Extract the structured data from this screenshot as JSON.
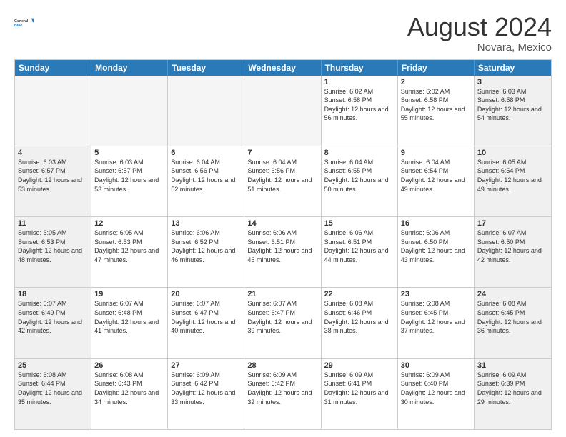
{
  "header": {
    "logo_line1": "General",
    "logo_line2": "Blue",
    "main_title": "August 2024",
    "subtitle": "Novara, Mexico"
  },
  "calendar": {
    "day_headers": [
      "Sunday",
      "Monday",
      "Tuesday",
      "Wednesday",
      "Thursday",
      "Friday",
      "Saturday"
    ],
    "rows": [
      [
        {
          "day": "",
          "empty": true
        },
        {
          "day": "",
          "empty": true
        },
        {
          "day": "",
          "empty": true
        },
        {
          "day": "",
          "empty": true
        },
        {
          "day": "1",
          "sunrise": "6:02 AM",
          "sunset": "6:58 PM",
          "daylight": "12 hours and 56 minutes."
        },
        {
          "day": "2",
          "sunrise": "6:02 AM",
          "sunset": "6:58 PM",
          "daylight": "12 hours and 55 minutes."
        },
        {
          "day": "3",
          "sunrise": "6:03 AM",
          "sunset": "6:58 PM",
          "daylight": "12 hours and 54 minutes."
        }
      ],
      [
        {
          "day": "4",
          "sunrise": "6:03 AM",
          "sunset": "6:57 PM",
          "daylight": "12 hours and 53 minutes."
        },
        {
          "day": "5",
          "sunrise": "6:03 AM",
          "sunset": "6:57 PM",
          "daylight": "12 hours and 53 minutes."
        },
        {
          "day": "6",
          "sunrise": "6:04 AM",
          "sunset": "6:56 PM",
          "daylight": "12 hours and 52 minutes."
        },
        {
          "day": "7",
          "sunrise": "6:04 AM",
          "sunset": "6:56 PM",
          "daylight": "12 hours and 51 minutes."
        },
        {
          "day": "8",
          "sunrise": "6:04 AM",
          "sunset": "6:55 PM",
          "daylight": "12 hours and 50 minutes."
        },
        {
          "day": "9",
          "sunrise": "6:04 AM",
          "sunset": "6:54 PM",
          "daylight": "12 hours and 49 minutes."
        },
        {
          "day": "10",
          "sunrise": "6:05 AM",
          "sunset": "6:54 PM",
          "daylight": "12 hours and 49 minutes."
        }
      ],
      [
        {
          "day": "11",
          "sunrise": "6:05 AM",
          "sunset": "6:53 PM",
          "daylight": "12 hours and 48 minutes."
        },
        {
          "day": "12",
          "sunrise": "6:05 AM",
          "sunset": "6:53 PM",
          "daylight": "12 hours and 47 minutes."
        },
        {
          "day": "13",
          "sunrise": "6:06 AM",
          "sunset": "6:52 PM",
          "daylight": "12 hours and 46 minutes."
        },
        {
          "day": "14",
          "sunrise": "6:06 AM",
          "sunset": "6:51 PM",
          "daylight": "12 hours and 45 minutes."
        },
        {
          "day": "15",
          "sunrise": "6:06 AM",
          "sunset": "6:51 PM",
          "daylight": "12 hours and 44 minutes."
        },
        {
          "day": "16",
          "sunrise": "6:06 AM",
          "sunset": "6:50 PM",
          "daylight": "12 hours and 43 minutes."
        },
        {
          "day": "17",
          "sunrise": "6:07 AM",
          "sunset": "6:50 PM",
          "daylight": "12 hours and 42 minutes."
        }
      ],
      [
        {
          "day": "18",
          "sunrise": "6:07 AM",
          "sunset": "6:49 PM",
          "daylight": "12 hours and 42 minutes."
        },
        {
          "day": "19",
          "sunrise": "6:07 AM",
          "sunset": "6:48 PM",
          "daylight": "12 hours and 41 minutes."
        },
        {
          "day": "20",
          "sunrise": "6:07 AM",
          "sunset": "6:47 PM",
          "daylight": "12 hours and 40 minutes."
        },
        {
          "day": "21",
          "sunrise": "6:07 AM",
          "sunset": "6:47 PM",
          "daylight": "12 hours and 39 minutes."
        },
        {
          "day": "22",
          "sunrise": "6:08 AM",
          "sunset": "6:46 PM",
          "daylight": "12 hours and 38 minutes."
        },
        {
          "day": "23",
          "sunrise": "6:08 AM",
          "sunset": "6:45 PM",
          "daylight": "12 hours and 37 minutes."
        },
        {
          "day": "24",
          "sunrise": "6:08 AM",
          "sunset": "6:45 PM",
          "daylight": "12 hours and 36 minutes."
        }
      ],
      [
        {
          "day": "25",
          "sunrise": "6:08 AM",
          "sunset": "6:44 PM",
          "daylight": "12 hours and 35 minutes."
        },
        {
          "day": "26",
          "sunrise": "6:08 AM",
          "sunset": "6:43 PM",
          "daylight": "12 hours and 34 minutes."
        },
        {
          "day": "27",
          "sunrise": "6:09 AM",
          "sunset": "6:42 PM",
          "daylight": "12 hours and 33 minutes."
        },
        {
          "day": "28",
          "sunrise": "6:09 AM",
          "sunset": "6:42 PM",
          "daylight": "12 hours and 32 minutes."
        },
        {
          "day": "29",
          "sunrise": "6:09 AM",
          "sunset": "6:41 PM",
          "daylight": "12 hours and 31 minutes."
        },
        {
          "day": "30",
          "sunrise": "6:09 AM",
          "sunset": "6:40 PM",
          "daylight": "12 hours and 30 minutes."
        },
        {
          "day": "31",
          "sunrise": "6:09 AM",
          "sunset": "6:39 PM",
          "daylight": "12 hours and 29 minutes."
        }
      ]
    ]
  }
}
